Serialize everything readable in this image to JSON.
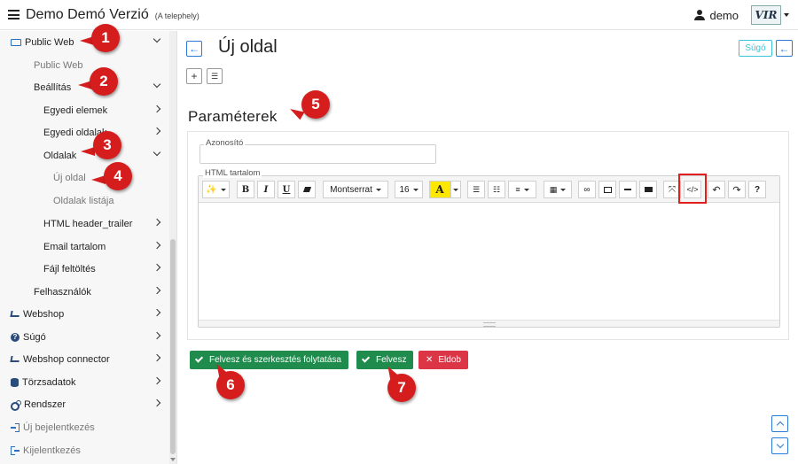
{
  "header": {
    "title": "Demo Demó Verzió",
    "subtitle": "(A telephely)",
    "user": "demo",
    "logo_text": "VIR"
  },
  "sidebar": {
    "items": [
      {
        "label": "Public Web",
        "icon": "laptop-icon",
        "chevron": "down"
      },
      {
        "label": "Public Web",
        "icon": "",
        "chevron": ""
      },
      {
        "label": "Beállítás",
        "icon": "",
        "chevron": "down"
      },
      {
        "label": "Egyedi elemek",
        "icon": "",
        "chevron": "right"
      },
      {
        "label": "Egyedi oldalak",
        "icon": "",
        "chevron": "right"
      },
      {
        "label": "Oldalak",
        "icon": "",
        "chevron": "down"
      },
      {
        "label": "Új oldal",
        "icon": "",
        "chevron": ""
      },
      {
        "label": "Oldalak listája",
        "icon": "",
        "chevron": ""
      },
      {
        "label": "HTML header_trailer",
        "icon": "",
        "chevron": "right"
      },
      {
        "label": "Email tartalom",
        "icon": "",
        "chevron": "right"
      },
      {
        "label": "Fájl feltöltés",
        "icon": "",
        "chevron": "right"
      },
      {
        "label": "Felhasználók",
        "icon": "",
        "chevron": "right"
      },
      {
        "label": "Webshop",
        "icon": "cart-icon",
        "chevron": "right"
      },
      {
        "label": "Súgó",
        "icon": "help-icon",
        "chevron": "right"
      },
      {
        "label": "Webshop connector",
        "icon": "cart-icon",
        "chevron": "right"
      },
      {
        "label": "Törzsadatok",
        "icon": "database-icon",
        "chevron": "right"
      },
      {
        "label": "Rendszer",
        "icon": "gears-icon",
        "chevron": "right"
      },
      {
        "label": "Új bejelentkezés",
        "icon": "login-icon",
        "chevron": ""
      },
      {
        "label": "Kijelentkezés",
        "icon": "logout-icon",
        "chevron": ""
      }
    ]
  },
  "main": {
    "page_title": "Új oldal",
    "help_label": "Súgó",
    "section_title": "Paraméterek",
    "field_id_label": "Azonosító",
    "field_id_value": "",
    "field_html_label": "HTML tartalom",
    "editor": {
      "font_name": "Montserrat",
      "font_size": "16",
      "bold": "B",
      "italic": "I",
      "underline": "U",
      "text_color": "A",
      "code_view": "</>",
      "help": "?"
    },
    "buttons": {
      "save_continue": "Felvesz és szerkesztés folytatása",
      "save": "Felvesz",
      "discard": "Eldob"
    }
  },
  "markers": [
    "1",
    "2",
    "3",
    "4",
    "5",
    "6",
    "7"
  ],
  "colors": {
    "accent": "#2b7ad8",
    "success": "#1f8b4c",
    "danger": "#dc3545",
    "marker": "#d51d1d",
    "help": "#3cc3dc"
  }
}
